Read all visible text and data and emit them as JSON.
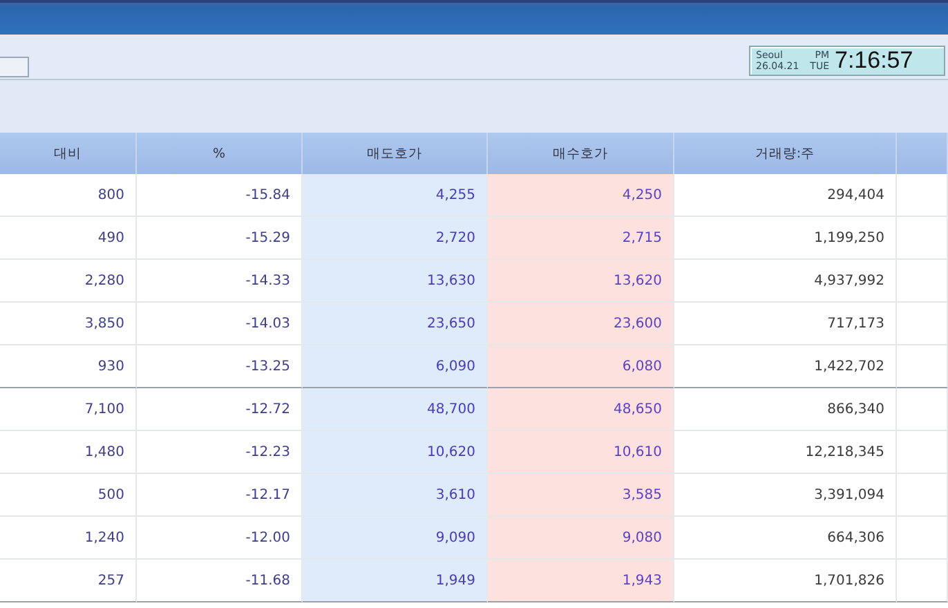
{
  "clock": {
    "city": "Seoul",
    "date": "26.04.21",
    "ampm": "PM",
    "weekday": "TUE",
    "time": "7:16:57"
  },
  "table": {
    "columns": [
      "대비",
      "%",
      "매도호가",
      "매수호가",
      "거래량:주"
    ],
    "rows": [
      [
        "800",
        "-15.84",
        "4,255",
        "4,250",
        "294,404"
      ],
      [
        "490",
        "-15.29",
        "2,720",
        "2,715",
        "1,199,250"
      ],
      [
        "2,280",
        "-14.33",
        "13,630",
        "13,620",
        "4,937,992"
      ],
      [
        "3,850",
        "-14.03",
        "23,650",
        "23,600",
        "717,173"
      ],
      [
        "930",
        "-13.25",
        "6,090",
        "6,080",
        "1,422,702"
      ],
      [
        "7,100",
        "-12.72",
        "48,700",
        "48,650",
        "866,340"
      ],
      [
        "1,480",
        "-12.23",
        "10,620",
        "10,610",
        "12,218,345"
      ],
      [
        "500",
        "-12.17",
        "3,610",
        "3,585",
        "3,391,094"
      ],
      [
        "1,240",
        "-12.00",
        "9,090",
        "9,080",
        "664,306"
      ],
      [
        "257",
        "-11.68",
        "1,949",
        "1,943",
        "1,701,826"
      ]
    ]
  }
}
